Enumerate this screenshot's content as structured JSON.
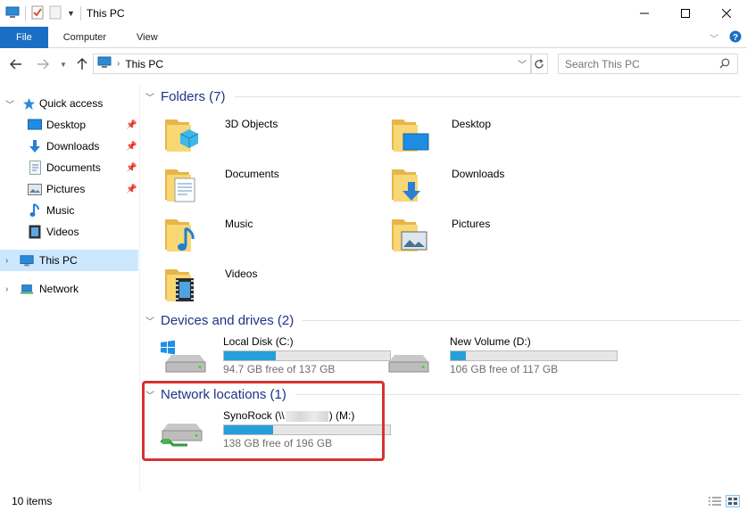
{
  "window": {
    "title": "This PC",
    "controls": {
      "minimize": "minimize-icon",
      "maximize": "maximize-icon",
      "close": "close-icon"
    }
  },
  "ribbon": {
    "tabs": [
      "File",
      "Computer",
      "View"
    ],
    "help_icon": "help-icon"
  },
  "address": {
    "path": "This PC",
    "search_placeholder": "Search This PC"
  },
  "nav": {
    "quick_access": "Quick access",
    "quick_items": [
      {
        "label": "Desktop",
        "pinned": true
      },
      {
        "label": "Downloads",
        "pinned": true
      },
      {
        "label": "Documents",
        "pinned": true
      },
      {
        "label": "Pictures",
        "pinned": true
      },
      {
        "label": "Music",
        "pinned": false
      },
      {
        "label": "Videos",
        "pinned": false
      }
    ],
    "this_pc": "This PC",
    "network": "Network"
  },
  "groups": {
    "folders": "Folders (7)",
    "devices": "Devices and drives (2)",
    "network": "Network locations (1)"
  },
  "folders": [
    {
      "label": "3D Objects",
      "icon": "3d-objects-folder-icon"
    },
    {
      "label": "Desktop",
      "icon": "desktop-folder-icon"
    },
    {
      "label": "Documents",
      "icon": "documents-folder-icon"
    },
    {
      "label": "Downloads",
      "icon": "downloads-folder-icon"
    },
    {
      "label": "Music",
      "icon": "music-folder-icon"
    },
    {
      "label": "Pictures",
      "icon": "pictures-folder-icon"
    },
    {
      "label": "Videos",
      "icon": "videos-folder-icon"
    }
  ],
  "drives": [
    {
      "name": "Local Disk (C:)",
      "free": "94.7 GB free of 137 GB",
      "used_fraction": 0.31
    },
    {
      "name": "New Volume (D:)",
      "free": "106 GB free of 117 GB",
      "used_fraction": 0.094
    }
  ],
  "network_drive": {
    "name_prefix": "SynoRock (\\\\",
    "name_suffix": ") (M:)",
    "free": "138 GB free of 196 GB",
    "used_fraction": 0.296
  },
  "status": {
    "count": "10 items"
  },
  "colors": {
    "accent": "#1a6fc4",
    "selection": "#cce8ff",
    "group_title": "#1e3287",
    "bar_fill": "#26a0da",
    "highlight": "#d63232"
  }
}
